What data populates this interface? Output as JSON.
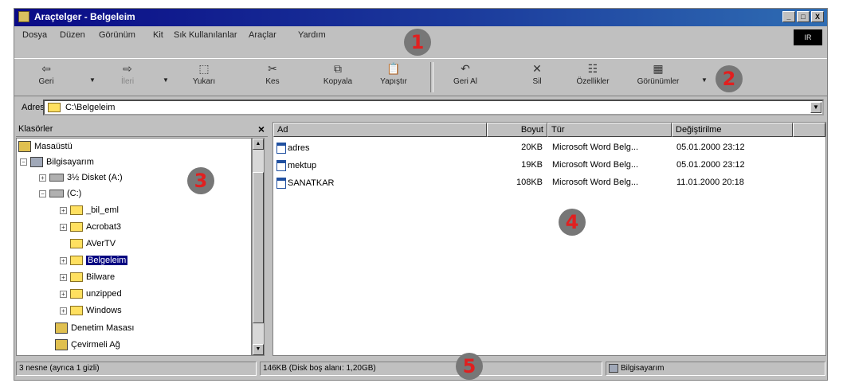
{
  "window": {
    "title": "Araçtelger - Belgeleim",
    "controls": [
      "_",
      "□",
      "X"
    ],
    "brand_logo": "IR"
  },
  "menu": [
    "Dosya",
    "Düzen",
    "Görünüm",
    "Kit",
    "Sık Kullanılanlar",
    "Araçlar",
    "Yardım"
  ],
  "toolbar": {
    "back": {
      "icon": "⇦",
      "label": "Geri"
    },
    "forward": {
      "icon": "⇨",
      "label": "İleri"
    },
    "up": {
      "icon": "⬚",
      "label": "Yukarı"
    },
    "cut": {
      "icon": "✂",
      "label": "Kes"
    },
    "copy": {
      "icon": "⧉",
      "label": "Kopyala"
    },
    "paste": {
      "icon": "📋",
      "label": "Yapıştır"
    },
    "undo": {
      "icon": "↶",
      "label": "Geri Al"
    },
    "delete": {
      "icon": "✕",
      "label": "Sil"
    },
    "properties": {
      "icon": "☷",
      "label": "Özellikler"
    },
    "views": {
      "icon": "▦",
      "label": "Görünümler"
    }
  },
  "address": {
    "label": "Adres",
    "value": "C:\\Belgeleim"
  },
  "folders_pane": {
    "title": "Klasörler",
    "close": "×",
    "items": [
      {
        "label": "Masaüstü",
        "icon": "desktop-icon",
        "exp": ""
      },
      {
        "label": "Bilgisayarım",
        "icon": "computer-icon",
        "exp": "−"
      },
      {
        "label": "3½ Disket (A:)",
        "icon": "floppy-drive-icon",
        "exp": "+"
      },
      {
        "label": "(C:)",
        "icon": "hard-drive-icon",
        "exp": "−"
      },
      {
        "label": "_bil_eml",
        "icon": "folder-icon",
        "exp": "+"
      },
      {
        "label": "Acrobat3",
        "icon": "folder-icon",
        "exp": "+"
      },
      {
        "label": "AVerTV",
        "icon": "folder-icon",
        "exp": ""
      },
      {
        "label": "Belgeleim",
        "icon": "folder-icon",
        "exp": "+",
        "selected": true
      },
      {
        "label": "Bilware",
        "icon": "folder-icon",
        "exp": "+"
      },
      {
        "label": "unzipped",
        "icon": "folder-icon",
        "exp": "+"
      },
      {
        "label": "Windows",
        "icon": "folder-icon",
        "exp": "+"
      },
      {
        "label": "Denetim Masası",
        "icon": "control-panel-icon",
        "exp": ""
      },
      {
        "label": "Çevirmeli Ağ",
        "icon": "dialup-icon",
        "exp": ""
      }
    ]
  },
  "file_list": {
    "columns": [
      "Ad",
      "Boyut",
      "Tür",
      "Değiştirilme"
    ],
    "rows": [
      {
        "name": "adres",
        "size": "20KB",
        "type": "Microsoft Word Belg...",
        "modified": "05.01.2000 23:12"
      },
      {
        "name": "mektup",
        "size": "19KB",
        "type": "Microsoft Word Belg...",
        "modified": "05.01.2000 23:12"
      },
      {
        "name": "SANATKAR",
        "size": "108KB",
        "type": "Microsoft Word Belg...",
        "modified": "11.01.2000 20:18"
      }
    ]
  },
  "statusbar": {
    "left": "3 nesne (ayrıca 1 gizli)",
    "middle": "146KB (Disk boş alanı: 1,20GB)",
    "right": "Bilgisayarım"
  },
  "markers": [
    "1",
    "2",
    "3",
    "4",
    "5"
  ]
}
